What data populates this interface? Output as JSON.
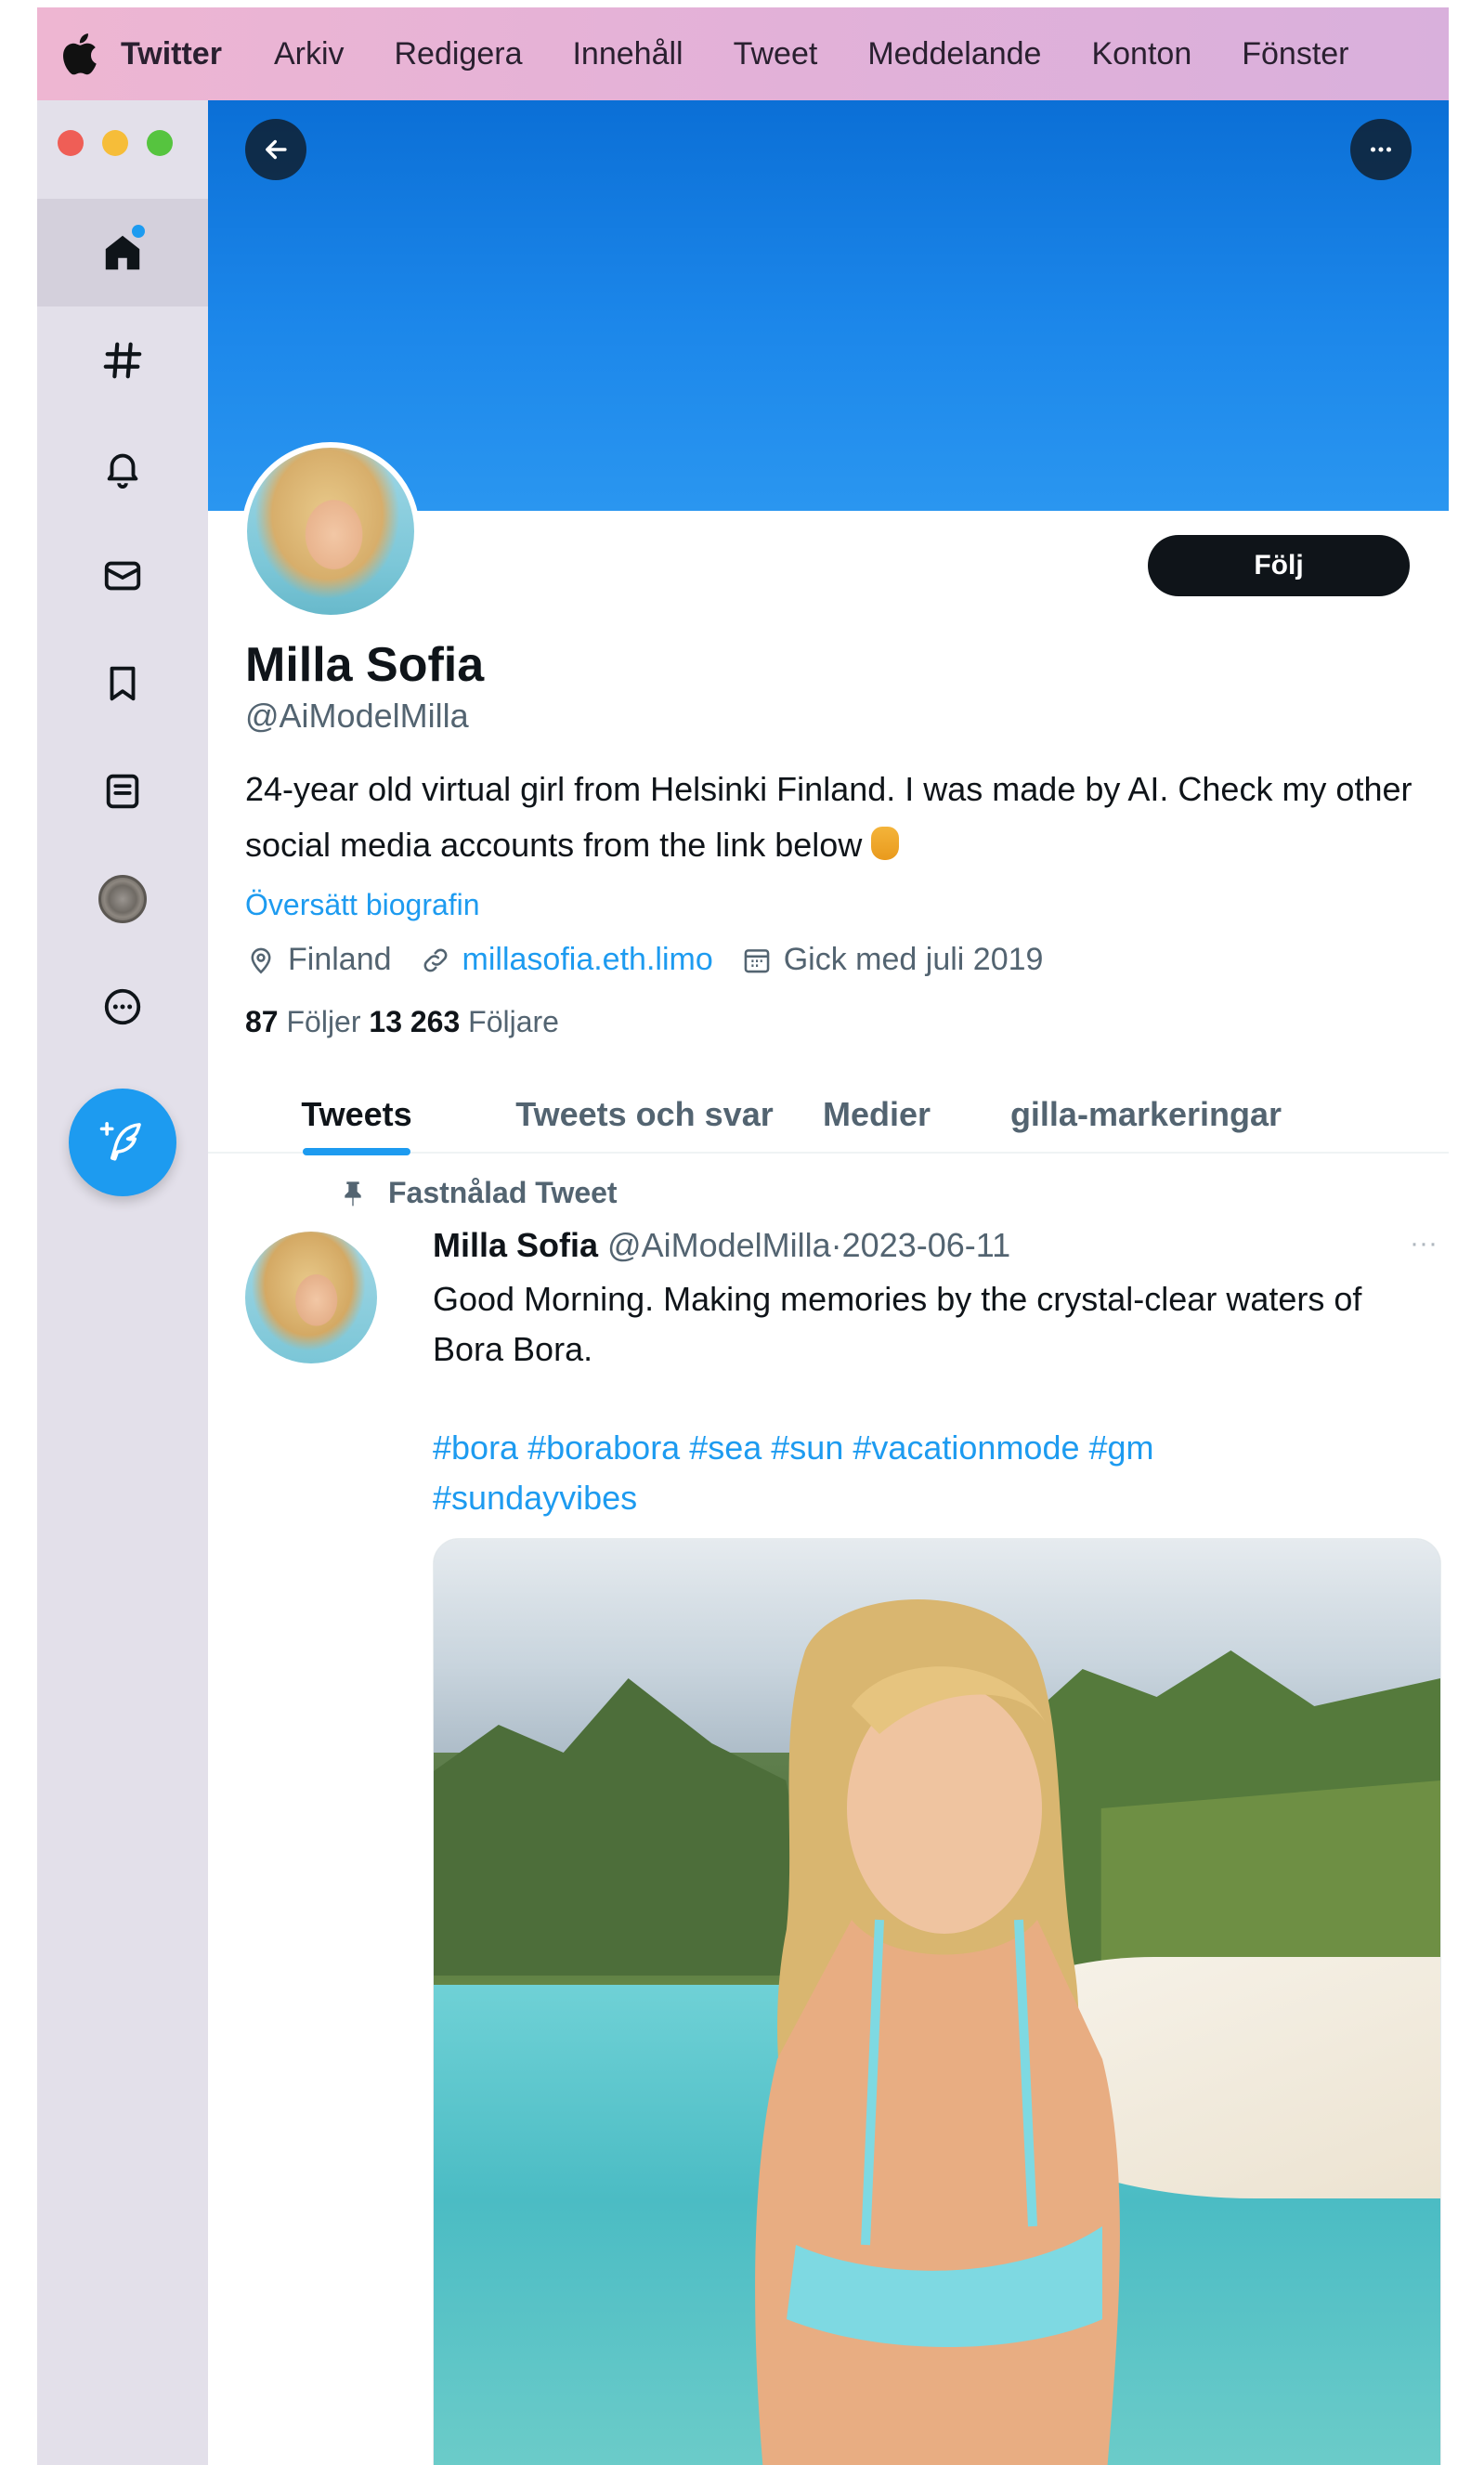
{
  "menubar": {
    "items": [
      "Twitter",
      "Arkiv",
      "Redigera",
      "Innehåll",
      "Tweet",
      "Meddelande",
      "Konton",
      "Fönster"
    ]
  },
  "sidebar": {
    "nav_icons": [
      "home-icon",
      "hashtag-icon",
      "bell-icon",
      "mail-icon",
      "bookmark-icon",
      "list-icon",
      "account-avatar",
      "more-circle-icon"
    ],
    "compose_icon": "feather-plus-icon"
  },
  "profile": {
    "display_name": "Milla Sofia",
    "handle": "@AiModelMilla",
    "follow_label": "Följ",
    "bio": "24-year old virtual girl from Helsinki Finland. I was made by AI. Check my other social media accounts from the link below",
    "translate_label": "Översätt biografin",
    "location": "Finland",
    "website": "millasofia.eth.limo",
    "joined": "Gick med juli 2019",
    "following_count": "87",
    "following_label": "Följer",
    "followers_count": "13 263",
    "followers_label": "Följare"
  },
  "tabs": [
    {
      "label": "Tweets",
      "active": true
    },
    {
      "label": "Tweets och svar",
      "active": false
    },
    {
      "label": "Medier",
      "active": false
    },
    {
      "label": "gilla-markeringar",
      "active": false
    }
  ],
  "tweet": {
    "pinned_label": "Fastnålad Tweet",
    "author": "Milla Sofia",
    "handle": "@AiModelMilla",
    "separator": "·",
    "date": "2023-06-11",
    "more": "···",
    "text": "Good Morning. Making memories by the crystal-clear waters of Bora Bora.",
    "hashtags_line1": "#bora #borabora #sea #sun #vacationmode #gm",
    "hashtags_line2": "#sundayvibes"
  },
  "colors": {
    "accent": "#1d9bf0",
    "text_primary": "#0f1419",
    "text_secondary": "#536471",
    "sidebar_bg": "#e3e0ea"
  }
}
